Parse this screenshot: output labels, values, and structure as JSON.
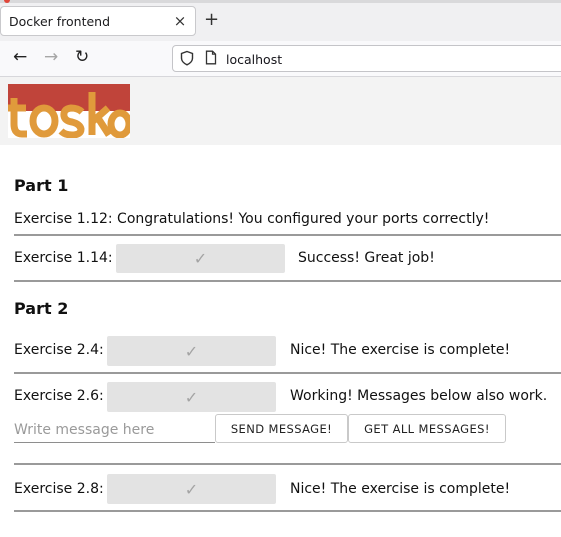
{
  "browser": {
    "tab_title": "Docker frontend",
    "tab_close": "×",
    "new_tab": "+",
    "back": "←",
    "forward": "→",
    "reload": "↻",
    "url": "localhost"
  },
  "page": {
    "logo_text": "toska",
    "logo_colors": [
      "#c0443a",
      "#e09a3b"
    ],
    "part1": {
      "title": "Part 1",
      "ex112": "Exercise 1.12: Congratulations! You configured your ports correctly!",
      "ex114": {
        "label": "Exercise 1.14:",
        "check": "✓",
        "status": "Success! Great job!"
      }
    },
    "part2": {
      "title": "Part 2",
      "ex24": {
        "label": "Exercise 2.4:",
        "check": "✓",
        "status": "Nice! The exercise is complete!"
      },
      "ex26": {
        "label": "Exercise 2.6:",
        "check": "✓",
        "status": "Working! Messages below also work."
      },
      "message_placeholder": "Write message here",
      "send_label": "SEND MESSAGE!",
      "get_label": "GET ALL MESSAGES!",
      "ex28": {
        "label": "Exercise 2.8:",
        "check": "✓",
        "status": "Nice! The exercise is complete!"
      }
    }
  }
}
